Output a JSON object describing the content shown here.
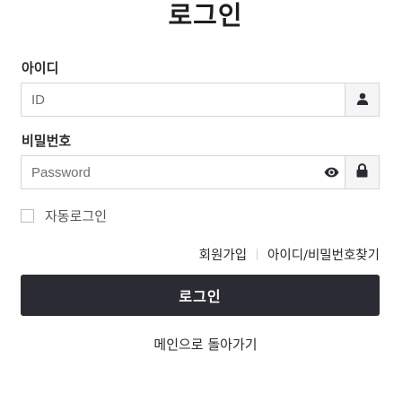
{
  "page": {
    "title": "로그인"
  },
  "form": {
    "id_label": "아이디",
    "id_placeholder": "ID",
    "id_icon": "user-icon",
    "password_label": "비밀번호",
    "password_placeholder": "Password",
    "password_toggle_icon": "eye-icon",
    "password_icon": "lock-icon",
    "remember_label": "자동로그인",
    "remember_checked": false
  },
  "links": {
    "signup": "회원가입",
    "find_account": "아이디/비밀번호찾기"
  },
  "actions": {
    "login_button": "로그인",
    "back_to_main": "메인으로 돌아가기"
  },
  "colors": {
    "button_bg": "#2b2b33",
    "border": "#d6d6d6",
    "icon_box_bg": "#f5f5f5"
  }
}
